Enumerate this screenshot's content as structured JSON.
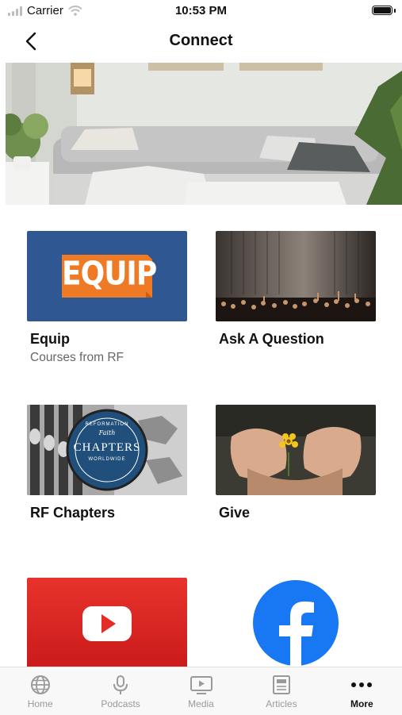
{
  "status_bar": {
    "carrier": "Carrier",
    "time": "10:53 PM"
  },
  "nav": {
    "title": "Connect"
  },
  "tiles": [
    {
      "label": "Equip",
      "subtitle": "Courses from RF",
      "logo_text": "EQUIP"
    },
    {
      "label": "Ask A Question",
      "subtitle": ""
    },
    {
      "label": "RF Chapters",
      "subtitle": "",
      "badge_top": "REFORMATION",
      "badge_brand": "Faith",
      "badge_main": "CHAPTERS",
      "badge_sub": "WORLDWIDE"
    },
    {
      "label": "Give",
      "subtitle": ""
    }
  ],
  "social": [
    {
      "icon": "youtube-icon",
      "color": "#e52d27"
    },
    {
      "icon": "facebook-icon",
      "color": "#1877f2"
    }
  ],
  "tabbar": [
    {
      "label": "Home",
      "icon": "globe-icon"
    },
    {
      "label": "Podcasts",
      "icon": "microphone-icon"
    },
    {
      "label": "Media",
      "icon": "tv-play-icon"
    },
    {
      "label": "Articles",
      "icon": "newspaper-icon"
    },
    {
      "label": "More",
      "icon": "ellipsis-icon",
      "active": true
    }
  ]
}
